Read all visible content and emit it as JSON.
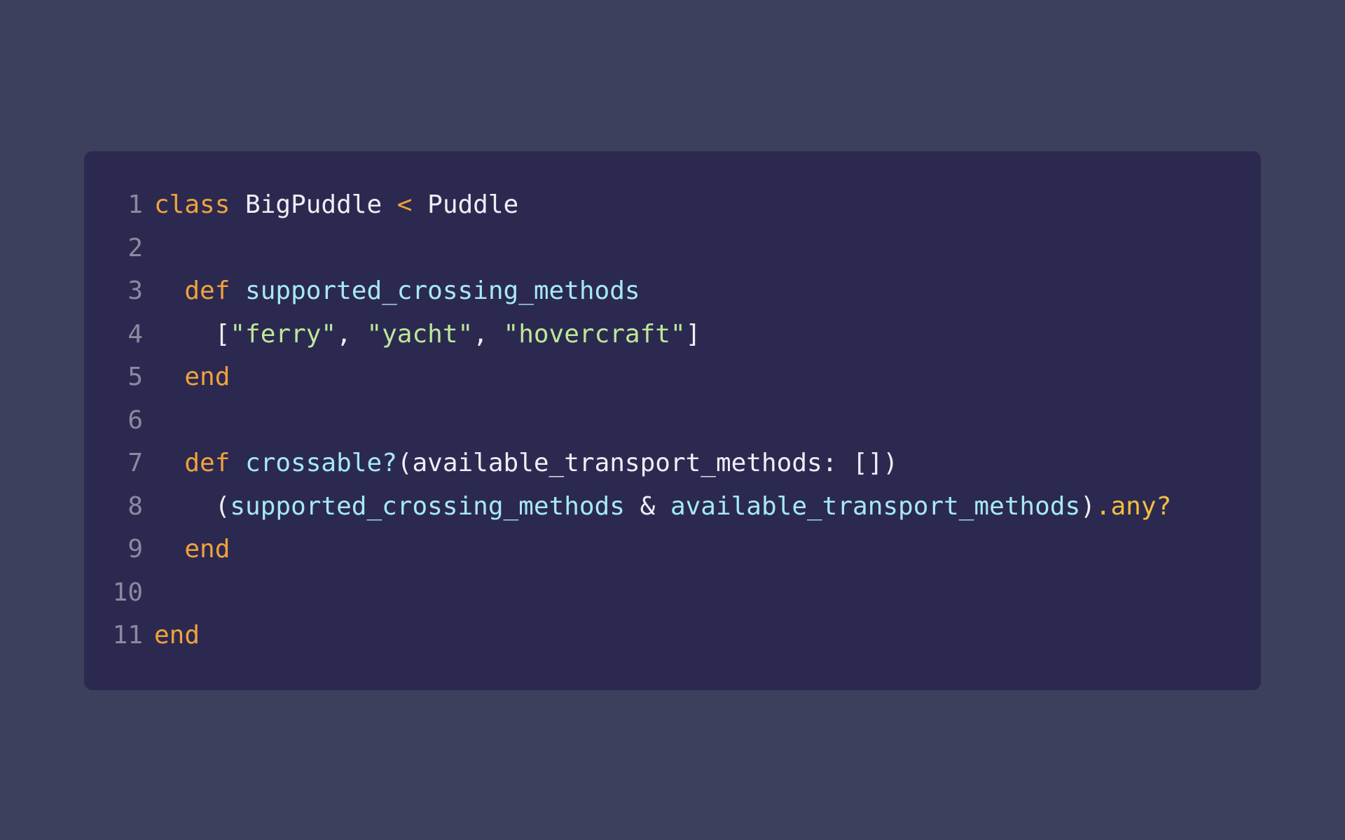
{
  "editor": {
    "lines": [
      {
        "number": "1",
        "tokens": [
          {
            "text": "class",
            "kind": "keyword"
          },
          {
            "text": " BigPuddle ",
            "kind": "plain"
          },
          {
            "text": "<",
            "kind": "keyword"
          },
          {
            "text": " Puddle",
            "kind": "plain"
          }
        ]
      },
      {
        "number": "2",
        "tokens": []
      },
      {
        "number": "3",
        "tokens": [
          {
            "text": "  def",
            "kind": "keyword"
          },
          {
            "text": " ",
            "kind": "plain"
          },
          {
            "text": "supported_crossing_methods",
            "kind": "method"
          }
        ]
      },
      {
        "number": "4",
        "tokens": [
          {
            "text": "    [",
            "kind": "plain"
          },
          {
            "text": "\"ferry\"",
            "kind": "string"
          },
          {
            "text": ", ",
            "kind": "plain"
          },
          {
            "text": "\"yacht\"",
            "kind": "string"
          },
          {
            "text": ", ",
            "kind": "plain"
          },
          {
            "text": "\"hovercraft\"",
            "kind": "string"
          },
          {
            "text": "]",
            "kind": "plain"
          }
        ]
      },
      {
        "number": "5",
        "tokens": [
          {
            "text": "  end",
            "kind": "keyword"
          }
        ]
      },
      {
        "number": "6",
        "tokens": []
      },
      {
        "number": "7",
        "tokens": [
          {
            "text": "  def",
            "kind": "keyword"
          },
          {
            "text": " ",
            "kind": "plain"
          },
          {
            "text": "crossable?",
            "kind": "method"
          },
          {
            "text": "(available_transport_methods: [])",
            "kind": "plain"
          }
        ]
      },
      {
        "number": "8",
        "tokens": [
          {
            "text": "    (",
            "kind": "plain"
          },
          {
            "text": "supported_crossing_methods",
            "kind": "method"
          },
          {
            "text": " & ",
            "kind": "plain"
          },
          {
            "text": "available_transport_methods",
            "kind": "method"
          },
          {
            "text": ")",
            "kind": "plain"
          },
          {
            "text": ".any?",
            "kind": "accent"
          }
        ]
      },
      {
        "number": "9",
        "tokens": [
          {
            "text": "  end",
            "kind": "keyword"
          }
        ]
      },
      {
        "number": "10",
        "tokens": []
      },
      {
        "number": "11",
        "tokens": [
          {
            "text": "end",
            "kind": "keyword"
          }
        ]
      }
    ]
  },
  "colors": {
    "page_background": "#3d405c",
    "card_background": "#2c2951",
    "keyword": "#f0a23c",
    "plain": "#eeeef4",
    "method": "#a6e9f3",
    "string": "#bde898",
    "accent": "#f5bf3c",
    "line_number": "#8a8aa0"
  }
}
